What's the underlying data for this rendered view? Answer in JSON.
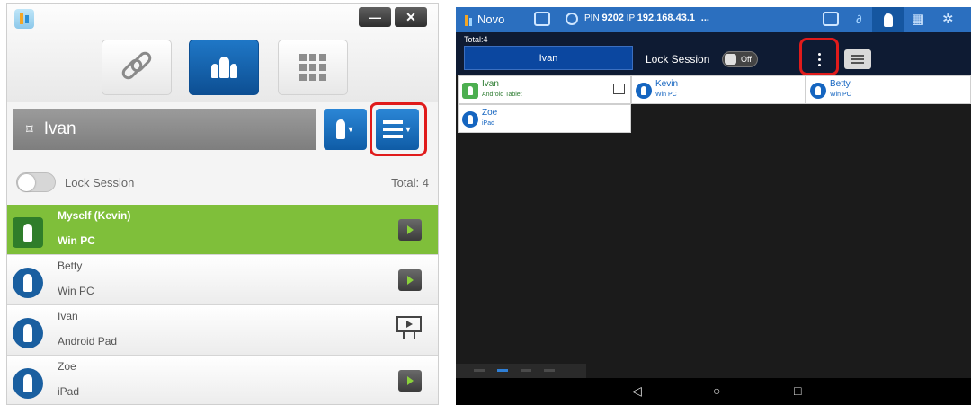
{
  "desktop": {
    "window_buttons": {
      "minimize": "—",
      "close": "✕"
    },
    "modes": [
      "link-icon",
      "people-icon",
      "grid-icon"
    ],
    "presenter_name": "Ivan",
    "lock_label": "Lock Session",
    "total": "Total: 4",
    "users": [
      {
        "name": "Myself (Kevin)",
        "device": "Win PC",
        "role": "self"
      },
      {
        "name": "Betty",
        "device": "Win PC",
        "role": "user"
      },
      {
        "name": "Ivan",
        "device": "Android Pad",
        "role": "presenter"
      },
      {
        "name": "Zoe",
        "device": "iPad",
        "role": "user"
      }
    ]
  },
  "android": {
    "app_name": "Novo",
    "pin_prefix": "PIN",
    "pin": "9202",
    "ip_prefix": "IP",
    "ip": "192.168.43.1",
    "ellipsis": "...",
    "total": "Total:4",
    "presenter_name": "Ivan",
    "lock_label": "Lock Session",
    "lock_state": "Off",
    "users": [
      {
        "name": "Ivan",
        "device": "Android Tablet",
        "role": "presenter"
      },
      {
        "name": "Kevin",
        "device": "Win PC",
        "role": "user"
      },
      {
        "name": "Betty",
        "device": "Win PC",
        "role": "user"
      },
      {
        "name": "Zoe",
        "device": "iPad",
        "role": "user"
      }
    ],
    "nav": {
      "back": "◁",
      "home": "○",
      "recent": "□"
    }
  },
  "colors": {
    "accent_blue": "#1f77c6",
    "self_green": "#7fbf3a",
    "highlight_red": "#e01b1b",
    "status_bar": "#2b6fbf"
  }
}
